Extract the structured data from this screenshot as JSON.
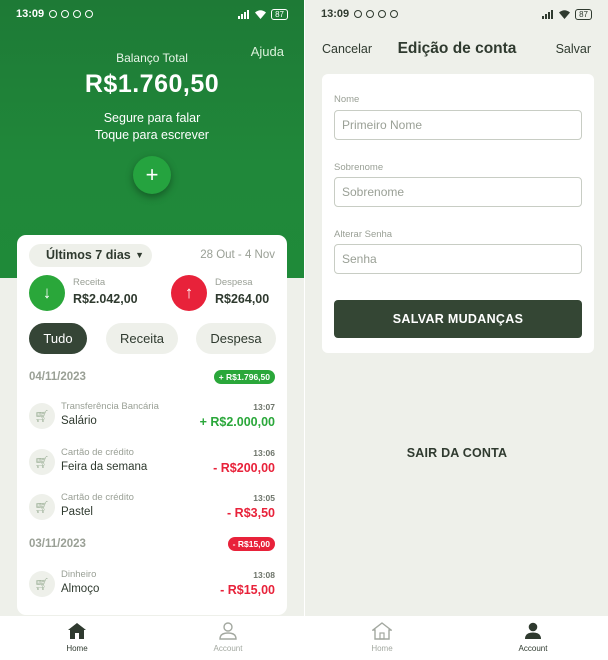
{
  "colors": {
    "primary_green": "#1f8a39",
    "income_green": "#2aa73a",
    "expense_red": "#e8223a",
    "dark_green": "#344634",
    "background": "#eef0ea"
  },
  "left_screen": {
    "status_bar": {
      "time": "13:09",
      "battery": "87"
    },
    "hero": {
      "help_label": "Ajuda",
      "balance_label": "Balanço Total",
      "balance_value": "R$1.760,50",
      "voice_hint_line1": "Segure para falar",
      "voice_hint_line2": "Toque para escrever",
      "add_button_icon": "plus-icon"
    },
    "summary": {
      "period": "Últimos 7 dias",
      "date_range": "28 Out - 4 Nov",
      "income": {
        "label": "Receita",
        "value": "R$2.042,00",
        "icon": "arrow-down-icon"
      },
      "expense": {
        "label": "Despesa",
        "value": "R$264,00",
        "icon": "arrow-up-icon"
      },
      "filters": [
        "Tudo",
        "Receita",
        "Despesa"
      ],
      "active_filter": "Tudo"
    },
    "days": [
      {
        "date": "04/11/2023",
        "total": "+ R$1.796,50",
        "transactions": [
          {
            "category": "Transferência Bancária",
            "name": "Salário",
            "time": "13:07",
            "amount": "+ R$2.000,00",
            "type": "income"
          },
          {
            "category": "Cartão de crédito",
            "name": "Feira da semana",
            "time": "13:06",
            "amount": "- R$200,00",
            "type": "expense"
          },
          {
            "category": "Cartão de crédito",
            "name": "Pastel",
            "time": "13:05",
            "amount": "- R$3,50",
            "type": "expense"
          }
        ]
      },
      {
        "date": "03/11/2023",
        "total": "- R$15,00",
        "transactions": [
          {
            "category": "Dinheiro",
            "name": "Almoço",
            "time": "13:08",
            "amount": "- R$15,00",
            "type": "expense"
          }
        ]
      }
    ],
    "nav": {
      "home_label": "Home",
      "account_label": "Account",
      "active": "Home"
    }
  },
  "right_screen": {
    "status_bar": {
      "time": "13:09",
      "battery": "87"
    },
    "header": {
      "cancel": "Cancelar",
      "title": "Edição de conta",
      "save": "Salvar"
    },
    "form": {
      "first_name_label": "Nome",
      "first_name_placeholder": "Primeiro Nome",
      "last_name_label": "Sobrenome",
      "last_name_placeholder": "Sobrenome",
      "password_label": "Alterar Senha",
      "password_placeholder": "Senha",
      "submit": "SALVAR MUDANÇAS"
    },
    "logout": "SAIR DA CONTA",
    "nav": {
      "home_label": "Home",
      "account_label": "Account",
      "active": "Account"
    }
  }
}
